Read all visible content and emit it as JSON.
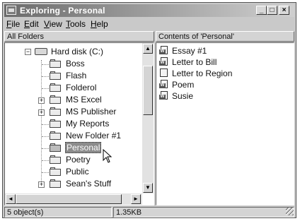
{
  "window": {
    "title": "Exploring - Personal",
    "buttons": {
      "minimize": "_",
      "maximize": "□",
      "close": "×"
    }
  },
  "menubar": {
    "items": [
      {
        "label": "File",
        "accel": "F"
      },
      {
        "label": "Edit",
        "accel": "E"
      },
      {
        "label": "View",
        "accel": "V"
      },
      {
        "label": "Tools",
        "accel": "T"
      },
      {
        "label": "Help",
        "accel": "H"
      }
    ]
  },
  "left_pane": {
    "header": "All Folders",
    "tree": [
      {
        "label": "Hard disk (C:)",
        "expander": "−",
        "type": "drive"
      },
      {
        "label": "Boss",
        "expander": ""
      },
      {
        "label": "Flash",
        "expander": ""
      },
      {
        "label": "Folderol",
        "expander": ""
      },
      {
        "label": "MS Excel",
        "expander": "+"
      },
      {
        "label": "MS Publisher",
        "expander": "+"
      },
      {
        "label": "My Reports",
        "expander": ""
      },
      {
        "label": "New Folder #1",
        "expander": ""
      },
      {
        "label": "Personal",
        "expander": "",
        "selected": true
      },
      {
        "label": "Poetry",
        "expander": ""
      },
      {
        "label": "Public",
        "expander": ""
      },
      {
        "label": "Sean's Stuff",
        "expander": "+"
      }
    ]
  },
  "right_pane": {
    "header": "Contents of 'Personal'",
    "files": [
      {
        "label": "Essay #1",
        "icon": "word-document-icon"
      },
      {
        "label": "Letter to Bill",
        "icon": "word-document-icon"
      },
      {
        "label": "Letter to Region",
        "icon": "text-document-icon"
      },
      {
        "label": "Poem",
        "icon": "word-document-icon"
      },
      {
        "label": "Susie",
        "icon": "word-document-icon"
      }
    ]
  },
  "statusbar": {
    "objects": "5 object(s)",
    "size": "1.35KB"
  },
  "scrollbar": {
    "position": 0.15,
    "arrows": {
      "up": "▲",
      "down": "▼",
      "left": "◄",
      "right": "►"
    }
  }
}
